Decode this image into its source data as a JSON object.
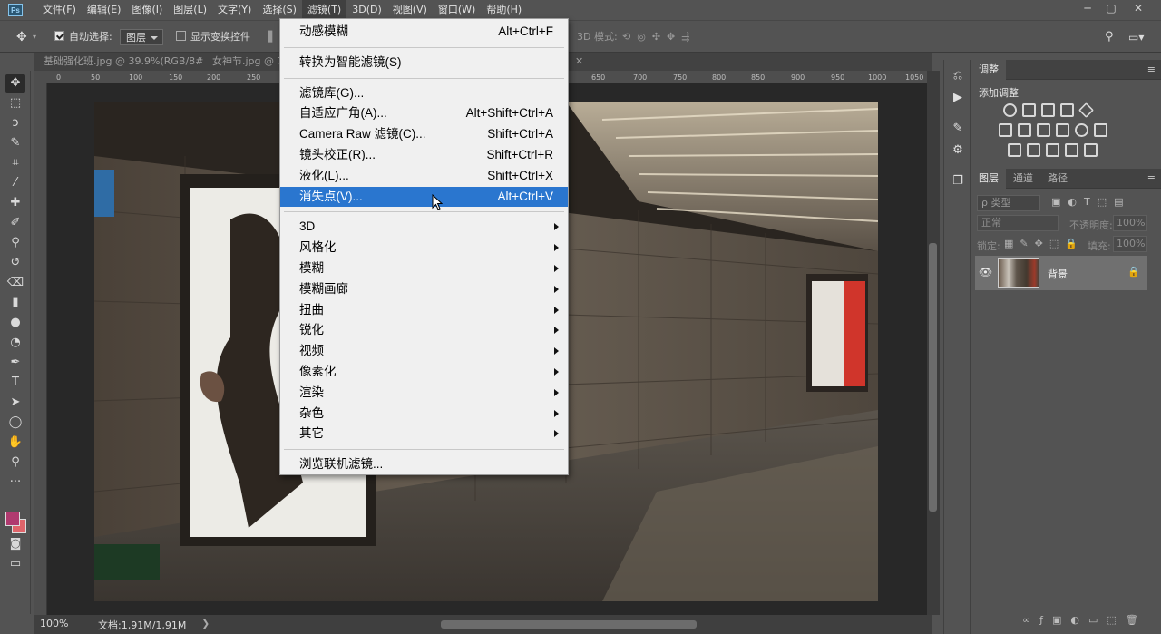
{
  "app": {
    "logo": "Ps"
  },
  "menubar": {
    "items": [
      "文件(F)",
      "编辑(E)",
      "图像(I)",
      "图层(L)",
      "文字(Y)",
      "选择(S)",
      "滤镜(T)",
      "3D(D)",
      "视图(V)",
      "窗口(W)",
      "帮助(H)"
    ],
    "active_index": 6
  },
  "window_controls": {
    "minimize": "─",
    "maximize": "▢",
    "close": "✕"
  },
  "options_bar": {
    "auto_select_label": "自动选择:",
    "auto_select_checked": true,
    "auto_select_value": "图层",
    "show_transform_label": "显示变换控件",
    "show_transform_checked": false,
    "mode_3d_label": "3D 模式:"
  },
  "tabs": [
    {
      "label": "基础强化班.jpg @ 39.9%(RGB/8#)",
      "close": "✕"
    },
    {
      "label": "女神节.jpg @ 7",
      "close": "✕"
    }
  ],
  "ruler": {
    "ticks": [
      "0",
      "50",
      "100",
      "150",
      "200",
      "250",
      "300",
      "650",
      "700",
      "750",
      "800",
      "850",
      "900",
      "950",
      "1000",
      "1050"
    ]
  },
  "status": {
    "zoom": "100%",
    "doc": "文档:1,91M/1,91M",
    "arrow": "❯"
  },
  "filter_menu": {
    "groups": [
      [
        {
          "label": "动感模糊",
          "shortcut": "Alt+Ctrl+F"
        }
      ],
      [
        {
          "label": "转换为智能滤镜(S)",
          "shortcut": ""
        }
      ],
      [
        {
          "label": "滤镜库(G)...",
          "shortcut": ""
        },
        {
          "label": "自适应广角(A)...",
          "shortcut": "Alt+Shift+Ctrl+A"
        },
        {
          "label": "Camera Raw 滤镜(C)...",
          "shortcut": "Shift+Ctrl+A"
        },
        {
          "label": "镜头校正(R)...",
          "shortcut": "Shift+Ctrl+R"
        },
        {
          "label": "液化(L)...",
          "shortcut": "Shift+Ctrl+X"
        },
        {
          "label": "消失点(V)...",
          "shortcut": "Alt+Ctrl+V",
          "highlighted": true
        }
      ],
      [
        {
          "label": "3D",
          "submenu": true
        },
        {
          "label": "风格化",
          "submenu": true
        },
        {
          "label": "模糊",
          "submenu": true
        },
        {
          "label": "模糊画廊",
          "submenu": true
        },
        {
          "label": "扭曲",
          "submenu": true
        },
        {
          "label": "锐化",
          "submenu": true
        },
        {
          "label": "视频",
          "submenu": true
        },
        {
          "label": "像素化",
          "submenu": true
        },
        {
          "label": "渲染",
          "submenu": true
        },
        {
          "label": "杂色",
          "submenu": true
        },
        {
          "label": "其它",
          "submenu": true
        }
      ],
      [
        {
          "label": "浏览联机滤镜...",
          "shortcut": ""
        }
      ]
    ]
  },
  "adjustments_panel": {
    "tab": "调整",
    "title": "添加调整"
  },
  "layers_panel": {
    "tabs": [
      "图层",
      "通道",
      "路径"
    ],
    "filter_placeholder": "ρ 类型",
    "blend_mode": "正常",
    "opacity_label": "不透明度:",
    "opacity_value": "100%",
    "lock_label": "锁定:",
    "fill_label": "填充:",
    "fill_value": "100%",
    "layer_name": "背景"
  },
  "colors": {
    "foreground": "#b03a6f",
    "background": "#e0646a",
    "highlight": "#2a76cf"
  }
}
